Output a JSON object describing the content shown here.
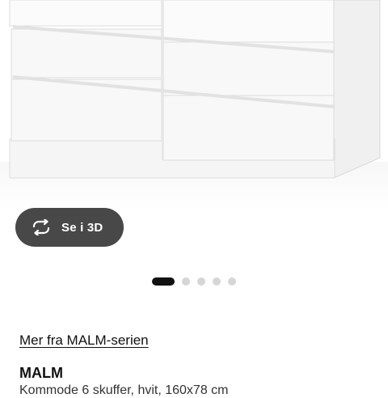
{
  "gallery": {
    "view_3d_label": "Se i 3D",
    "view_3d_icon": "rotate-arrows-icon",
    "slide_count": 5,
    "active_slide": 1
  },
  "product": {
    "series_link": "Mer fra MALM-serien",
    "name": "MALM",
    "description": "Kommode 6 skuffer, hvit, 160x78 cm"
  },
  "colors": {
    "button_bg": "#484848",
    "dot_active": "#111111",
    "dot_inactive": "#d6d6d6"
  }
}
